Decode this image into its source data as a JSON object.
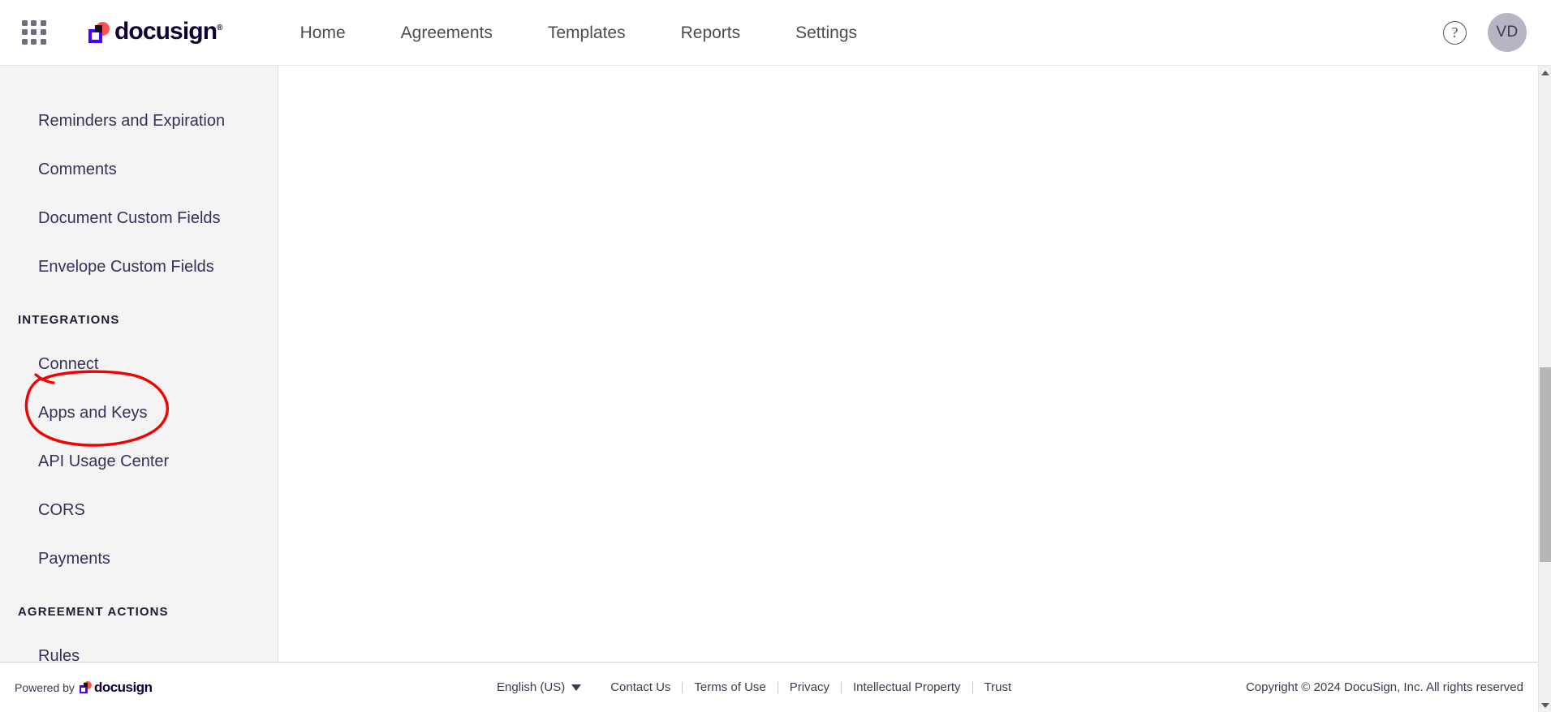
{
  "topnav": {
    "apps_icon": "apps-grid-icon",
    "brand": {
      "name": "docusign",
      "trademark": "®"
    },
    "links": [
      {
        "label": "Home"
      },
      {
        "label": "Agreements"
      },
      {
        "label": "Templates"
      },
      {
        "label": "Reports"
      },
      {
        "label": "Settings"
      }
    ],
    "help_icon": "?",
    "avatar_initials": "VD"
  },
  "sidebar": {
    "groups": [
      {
        "heading": null,
        "items": [
          {
            "label": "Reminders and Expiration"
          },
          {
            "label": "Comments"
          },
          {
            "label": "Document Custom Fields"
          },
          {
            "label": "Envelope Custom Fields"
          }
        ]
      },
      {
        "heading": "INTEGRATIONS",
        "items": [
          {
            "label": "Connect"
          },
          {
            "label": "Apps and Keys",
            "annotated": true
          },
          {
            "label": "API Usage Center"
          },
          {
            "label": "CORS"
          },
          {
            "label": "Payments"
          }
        ]
      },
      {
        "heading": "AGREEMENT ACTIONS",
        "items": [
          {
            "label": "Rules"
          }
        ]
      }
    ]
  },
  "annotation": {
    "type": "hand-drawn-ellipse",
    "target": "Apps and Keys",
    "color": "#f50000"
  },
  "footer": {
    "powered_by_label": "Powered by",
    "powered_by_brand": "docusign",
    "language": "English (US)",
    "links": [
      {
        "label": "Contact Us"
      },
      {
        "label": "Terms of Use"
      },
      {
        "label": "Privacy"
      },
      {
        "label": "Intellectual Property"
      },
      {
        "label": "Trust"
      }
    ],
    "copyright": "Copyright © 2024 DocuSign, Inc. All rights reserved"
  },
  "scrollbar": {
    "up_arrow": "scroll-up-arrow",
    "down_arrow": "scroll-down-arrow"
  },
  "colors": {
    "sidebar_bg": "#f4f4f4",
    "text": "#32325a",
    "annotation_red": "#f50000",
    "brand_purple": "#4c00ff",
    "brand_red": "#ff5252",
    "avatar_bg": "#b7b5c4"
  }
}
